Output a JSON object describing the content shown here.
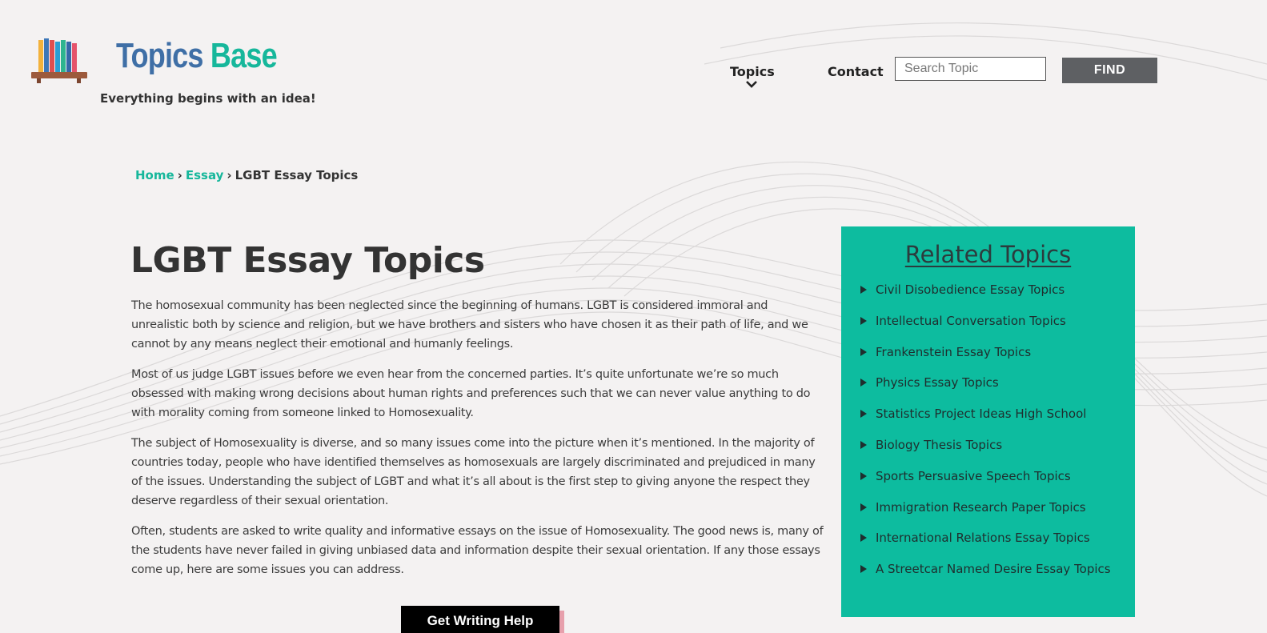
{
  "header": {
    "brand_part1": "Topics",
    "brand_part2": "Base",
    "tagline": "Everything begins with an idea!",
    "nav": {
      "topics_label": "Topics",
      "contact_label": "Contact"
    },
    "search": {
      "placeholder": "Search Topic",
      "value": "",
      "button_label": "FIND"
    }
  },
  "breadcrumb": {
    "home": "Home",
    "separator": "›",
    "section": "Essay",
    "current": "LGBT Essay Topics"
  },
  "main": {
    "title": "LGBT Essay Topics",
    "paragraphs": [
      "The homosexual community has been neglected since the beginning of humans. LGBT is considered immoral and unrealistic both by science and religion, but we have brothers and sisters who have chosen it as their path of life, and we cannot by any means neglect their emotional and humanly feelings.",
      "Most of us judge LGBT issues before we even hear from the concerned parties. It’s quite unfortunate we’re so much obsessed with making wrong decisions about human rights and preferences such that we can never value anything to do with morality coming from someone linked to Homosexuality.",
      "The subject of Homosexuality is diverse, and so many issues come into the picture when it’s mentioned. In the majority of countries today, people who have identified themselves as homosexuals are largely discriminated and prejudiced in many of the issues. Understanding the subject of LGBT and what it’s all about is the first step to giving anyone the respect they deserve regardless of their sexual orientation.",
      "Often, students are asked to write quality and informative essays on the issue of Homosexuality. The good news is, many of the students have never failed in giving unbiased data and information despite their sexual orientation. If any those essays come up, here are some issues you can address."
    ],
    "cta_label": "Get Writing Help"
  },
  "sidebar": {
    "title": "Related Topics",
    "items": [
      {
        "label": "Civil Disobedience Essay Topics"
      },
      {
        "label": "Intellectual Conversation Topics"
      },
      {
        "label": "Frankenstein Essay Topics"
      },
      {
        "label": "Physics Essay Topics"
      },
      {
        "label": "Statistics Project Ideas High School"
      },
      {
        "label": "Biology Thesis Topics"
      },
      {
        "label": "Sports Persuasive Speech Topics"
      },
      {
        "label": "Immigration Research Paper Topics"
      },
      {
        "label": "International Relations Essay Topics"
      },
      {
        "label": "A Streetcar Named Desire Essay Topics"
      }
    ]
  },
  "colors": {
    "accent": "#16b79b",
    "brand_blue": "#3f6fa6",
    "sidebar_bg": "#0dbc9f",
    "find_button": "#5e6063",
    "cta_bg": "#000000",
    "cta_shadow": "#e7a0ac"
  },
  "icons": {
    "logo": "bookshelf-icon",
    "topics_dropdown": "chevron-down-icon",
    "list_bullet": "triangle-right-icon"
  }
}
